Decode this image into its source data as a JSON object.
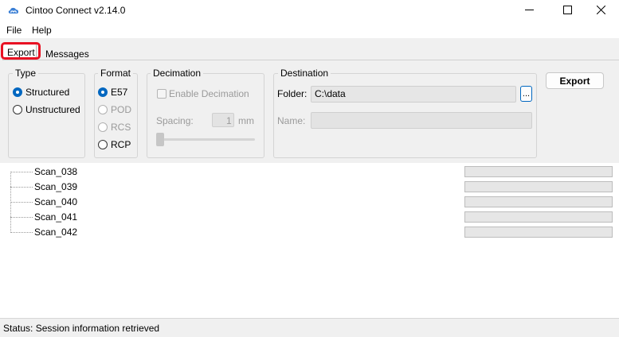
{
  "window": {
    "title": "Cintoo Connect v2.14.0"
  },
  "menu": [
    "File",
    "Help"
  ],
  "tabs": {
    "export": "Export",
    "messages": "Messages"
  },
  "type_group": {
    "title": "Type",
    "options": [
      "Structured",
      "Unstructured"
    ],
    "selected": "Structured"
  },
  "format_group": {
    "title": "Format",
    "options": [
      "E57",
      "POD",
      "RCS",
      "RCP"
    ],
    "selected": "E57"
  },
  "decimation_group": {
    "title": "Decimation",
    "enable_label": "Enable Decimation",
    "spacing_label": "Spacing:",
    "spacing_value": "1",
    "spacing_unit": "mm"
  },
  "destination_group": {
    "title": "Destination",
    "folder_label": "Folder:",
    "folder_value": "C:\\data",
    "browse_label": "...",
    "name_label": "Name:",
    "name_value": ""
  },
  "export_button": "Export",
  "scans": [
    {
      "name": "Scan_038",
      "progress": 0
    },
    {
      "name": "Scan_039",
      "progress": 0
    },
    {
      "name": "Scan_040",
      "progress": 0
    },
    {
      "name": "Scan_041",
      "progress": 0
    },
    {
      "name": "Scan_042",
      "progress": 0
    }
  ],
  "status": "Status: Session information retrieved",
  "colors": {
    "accent": "#0067c0",
    "highlight": "#e81123"
  },
  "icons": [
    "cloud-logo-icon",
    "minimize-icon",
    "maximize-icon",
    "close-icon"
  ]
}
